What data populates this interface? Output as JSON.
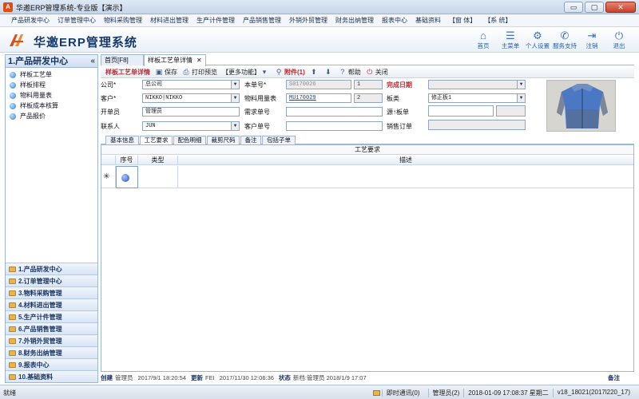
{
  "window": {
    "title": "华邀ERP管理系统-专业版【演示】",
    "buttons": {
      "minimize": "▭",
      "maximize": "▢",
      "close": "✕"
    }
  },
  "menu": [
    "产品研发中心",
    "订单管理中心",
    "物料采购管理",
    "材料进出管理",
    "生产计件管理",
    "产品销售管理",
    "外销外贸管理",
    "财务出纳管理",
    "报表中心",
    "基础资料",
    "【窗 体】",
    "【系 统】"
  ],
  "header": {
    "logo_text": "HA",
    "app_name": "华邀ERP管理系统",
    "icons": [
      {
        "label": "首页",
        "icon": "home-icon",
        "glyph": "⌂"
      },
      {
        "label": "主菜单",
        "icon": "menu-list-icon",
        "glyph": "☰"
      },
      {
        "label": "个人设置",
        "icon": "gear-icon",
        "glyph": "⚙"
      },
      {
        "label": "服务支持",
        "icon": "support-icon",
        "glyph": "✆"
      },
      {
        "label": "注销",
        "icon": "logout-icon",
        "glyph": "⇥"
      },
      {
        "label": "退出",
        "icon": "power-icon",
        "glyph": "⏻"
      }
    ]
  },
  "sidebar": {
    "title": "1.产品研发中心",
    "collapse": "«",
    "items": [
      "样板工艺单",
      "样板排程",
      "物料用量表",
      "样板成本核算",
      "产品报价"
    ],
    "groups": [
      "1.产品研发中心",
      "2.订单管理中心",
      "3.物料采购管理",
      "4.材料进出管理",
      "5.生产计件管理",
      "6.产品销售管理",
      "7.外销外贸管理",
      "8.财务出纳管理",
      "9.报表中心",
      "10.基础资料"
    ]
  },
  "tabs": [
    {
      "label": "首页[F8]"
    },
    {
      "label": "样板工艺单详情",
      "close": "✕"
    }
  ],
  "toolbar": {
    "title": "样板工艺单详情",
    "save": "保存",
    "print": "打印预览",
    "more": "【更多功能】",
    "attach": "附件(1)",
    "help": "帮助",
    "close": "关闭"
  },
  "form": {
    "company": {
      "label": "公司*",
      "value": "总公司"
    },
    "customer": {
      "label": "客户*",
      "value": "NIKKO|NIKKO"
    },
    "developer": {
      "label": "开单员",
      "value": "管理员"
    },
    "contact": {
      "label": "联系人",
      "value": "JUN"
    },
    "doc_no": {
      "label": "本单号*",
      "value": "S0170026",
      "seq": "1"
    },
    "bom": {
      "label": "物料用量表",
      "value": "MU170029",
      "seq": "2"
    },
    "demand_no": {
      "label": "需求单号",
      "value": ""
    },
    "cust_no": {
      "label": "客户单号",
      "value": ""
    },
    "finish_date": {
      "label": "完成日期",
      "value": ""
    },
    "board": {
      "label": "板类",
      "value": "修正板1"
    },
    "source": {
      "label": "源↑板单",
      "value": ""
    },
    "sales_order": {
      "label": "销售订单",
      "value": ""
    }
  },
  "subtabs": [
    "基本信息",
    "工艺要求",
    "配色明细",
    "裁剪尺码",
    "备注",
    "包括子单"
  ],
  "grid": {
    "title": "工艺要求",
    "columns": [
      "序号",
      "类型",
      "描述"
    ],
    "row_marker": "✳"
  },
  "audit": {
    "created_label": "创建",
    "created_by": "管理员",
    "created_at": "2017/9/1 18:20:54",
    "updated_label": "更新",
    "updated_by": "FEI",
    "updated_at": "2017/11/30 12:06:36",
    "status_label": "状态",
    "status_value": "新档:管理员 2018/1/9 17:07",
    "audit_label": "备注"
  },
  "status": {
    "left": "就绪",
    "messages": "即时通讯(0)",
    "user": "管理员(2)",
    "datetime": "2018-01-09  17:08:37  星期二",
    "version": "v18_18021(2017l220_17)"
  },
  "colors": {
    "accent_red": "#c0272d",
    "nav_blue": "#183a6b",
    "border_blue": "#9fb6d4"
  }
}
